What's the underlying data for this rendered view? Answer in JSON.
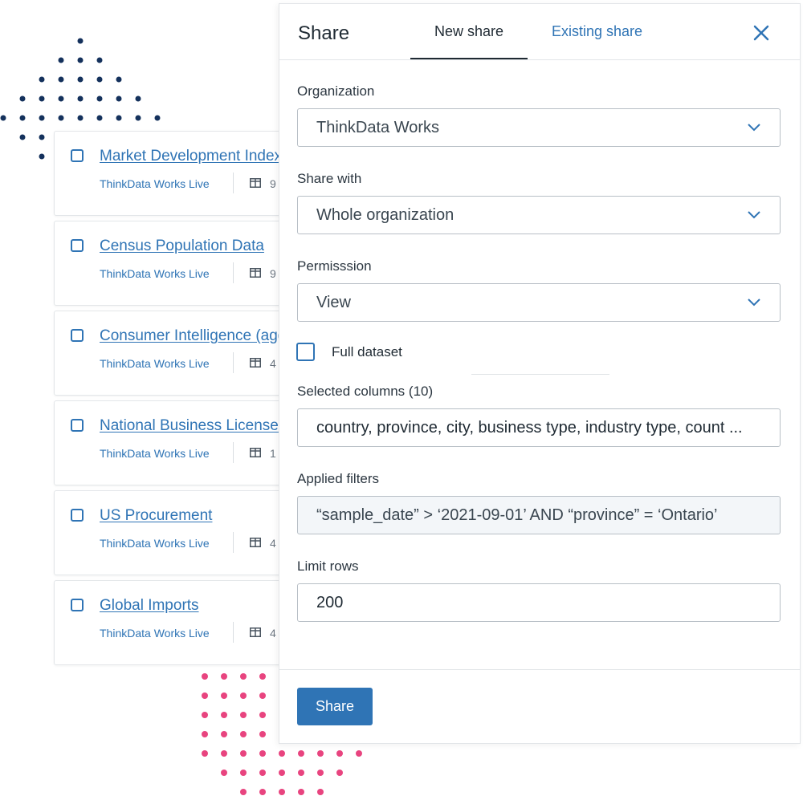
{
  "colors": {
    "accent": "#2f74b5",
    "navy_dots": "#14315c",
    "pink_dots": "#e8447f"
  },
  "datasets": [
    {
      "title": "Market Development Index",
      "provider": "ThinkData Works Live",
      "count": "9"
    },
    {
      "title": "Census Population Data",
      "provider": "ThinkData Works Live",
      "count": "9"
    },
    {
      "title": "Consumer Intelligence (agg",
      "provider": "ThinkData Works Live",
      "count": "4"
    },
    {
      "title": "National Business Licenses",
      "provider": "ThinkData Works Live",
      "count": "1"
    },
    {
      "title": "US Procurement",
      "provider": "ThinkData Works Live",
      "count": "4"
    },
    {
      "title": "Global Imports",
      "provider": "ThinkData Works Live",
      "count": "4"
    }
  ],
  "share_panel": {
    "title": "Share",
    "tabs": [
      "New share",
      "Existing share"
    ],
    "organization": {
      "label": "Organization",
      "value": "ThinkData Works"
    },
    "share_with": {
      "label": "Share with",
      "value": "Whole organization"
    },
    "permission": {
      "label": "Permisssion",
      "value": "View"
    },
    "full_dataset_label": "Full dataset",
    "selected_columns": {
      "label": "Selected columns (10)",
      "value": "country, province, city, business type, industry type, count ..."
    },
    "applied_filters": {
      "label": "Applied filters",
      "value": "“sample_date” > ‘2021-09-01’ AND “province” = ‘Ontario’"
    },
    "limit_rows": {
      "label": "Limit rows",
      "value": "200"
    },
    "share_button": "Share"
  }
}
